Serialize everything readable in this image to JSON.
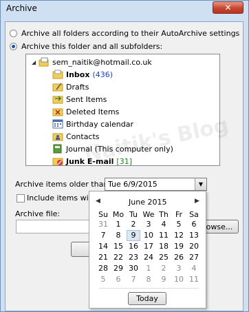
{
  "window": {
    "title": "Archive",
    "close_label": "✕"
  },
  "options": {
    "all_folders_label": "Archive all folders according to their AutoArchive settings",
    "this_folder_label": "Archive this folder and all subfolders:"
  },
  "tree": {
    "account": "sem_naitik@hotmail.co.uk",
    "items": [
      {
        "label": "Inbox",
        "count": "(436)",
        "bold": true
      },
      {
        "label": "Drafts"
      },
      {
        "label": "Sent Items"
      },
      {
        "label": "Deleted Items"
      },
      {
        "label": "Birthday calendar"
      },
      {
        "label": "Contacts"
      },
      {
        "label": "Journal (This computer only)"
      },
      {
        "label": "Junk E-mail",
        "count": "[31]",
        "bold": true
      }
    ]
  },
  "archive_older": {
    "label": "Archive items older than:",
    "value": "Tue 6/9/2015"
  },
  "include_label": "Include items with",
  "archive_file": {
    "label": "Archive file:",
    "browse_label": "owse..."
  },
  "calendar": {
    "month_label": "June 2015",
    "weekdays": [
      "Su",
      "Mo",
      "Tu",
      "We",
      "Th",
      "Fr",
      "Sa"
    ],
    "weeks": [
      [
        "31",
        "1",
        "2",
        "3",
        "4",
        "5",
        "6"
      ],
      [
        "7",
        "8",
        "9",
        "10",
        "11",
        "12",
        "13"
      ],
      [
        "14",
        "15",
        "16",
        "17",
        "18",
        "19",
        "20"
      ],
      [
        "21",
        "22",
        "23",
        "24",
        "25",
        "26",
        "27"
      ],
      [
        "28",
        "29",
        "30",
        "1",
        "2",
        "3",
        "4"
      ],
      [
        "5",
        "6",
        "7",
        "8",
        "9",
        "10",
        "11"
      ]
    ],
    "selected": "9",
    "today_label": "Today"
  },
  "watermark": "Naitik's Blog"
}
